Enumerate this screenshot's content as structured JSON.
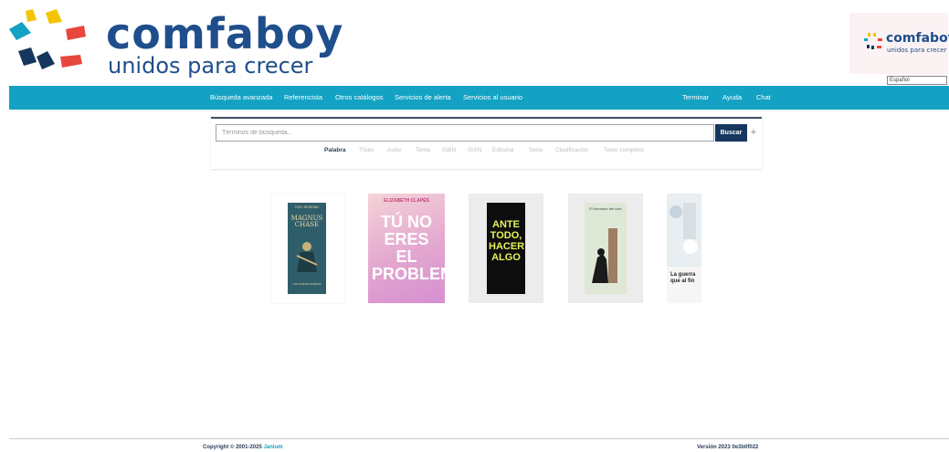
{
  "brand": {
    "name": "comfaboy",
    "tagline": "unidos para crecer",
    "colors": {
      "primary": "#1f4e8c",
      "yellow": "#f5c400",
      "red": "#e8473b",
      "teal": "#13a2c3",
      "navy": "#16365e"
    }
  },
  "language": {
    "selected": "Español"
  },
  "navbar": {
    "left": [
      {
        "label": "Búsqueda avanzada"
      },
      {
        "label": "Referencista"
      },
      {
        "label": "Otros catálogos"
      },
      {
        "label": "Servicios de alerta"
      },
      {
        "label": "Servicios al usuario"
      }
    ],
    "right": [
      {
        "label": "Terminar"
      },
      {
        "label": "Ayuda"
      },
      {
        "label": "Chat"
      }
    ]
  },
  "search": {
    "placeholder": "Términos de búsqueda...",
    "button_label": "Buscar",
    "plus_symbol": "+",
    "fields": [
      {
        "label": "Palabra",
        "active": true
      },
      {
        "label": "Título",
        "active": false
      },
      {
        "label": "Autor",
        "active": false
      },
      {
        "label": "Tema",
        "active": false
      },
      {
        "label": "ISBN",
        "active": false
      },
      {
        "label": "ISSN",
        "active": false
      },
      {
        "label": "Editorial",
        "active": false
      },
      {
        "label": "Serie",
        "active": false
      },
      {
        "label": "Clasificación",
        "active": false
      },
      {
        "label": "Texto completo",
        "active": false
      }
    ]
  },
  "books": [
    {
      "author": "RICK RIORDAN",
      "title": "MAGNUS CHASE",
      "subtitle": "LOS NUEVE MUNDOS"
    },
    {
      "author": "ELIZABETH CLAPÉS",
      "title": "TÚ NO ERES EL PROBLEMA"
    },
    {
      "title": "ANTE TODO, HACER ALGO"
    },
    {
      "title": "El hermano del lobo"
    },
    {
      "title": "La guerra que al fin"
    }
  ],
  "footer": {
    "copyright_prefix": "Copyright © 2001-2025",
    "copyright_brand": "Janium",
    "version": "Versión 2023 0e3b0f022"
  }
}
